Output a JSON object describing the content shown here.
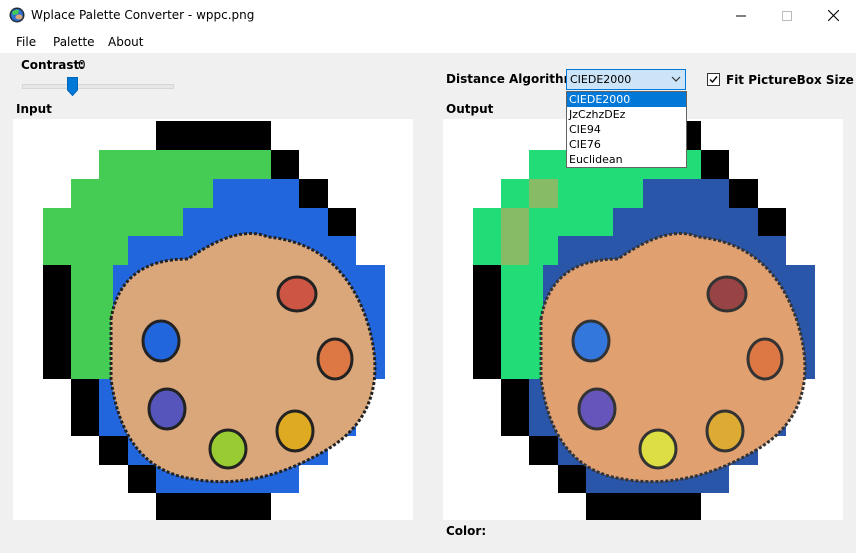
{
  "window": {
    "title": "Wplace Palette Converter - wppc.png"
  },
  "menu": {
    "items": [
      "File",
      "Palette",
      "About"
    ]
  },
  "contrast": {
    "label": "Contrast:",
    "value": "0",
    "level": 0
  },
  "algorithm": {
    "label": "Distance Algorithm:",
    "selected": "CIEDE2000",
    "options": [
      "CIEDE2000",
      "JzCzhzDEz",
      "CIE94",
      "CIE76",
      "Euclidean"
    ],
    "highlighted_index": 0
  },
  "fit": {
    "label": "Fit PictureBox Size",
    "checked": true
  },
  "input": {
    "label": "Input"
  },
  "output": {
    "label": "Output"
  },
  "color": {
    "label": "Color:"
  },
  "colors": {
    "accent": "#0078d7",
    "black": "#000000",
    "green_in": "#44cc55",
    "blue_in": "#2266dd",
    "palette_in": "#d9a77a",
    "green_out": "#22dd77",
    "blue_out": "#2a56aa",
    "palette_out": "#e0a070"
  }
}
